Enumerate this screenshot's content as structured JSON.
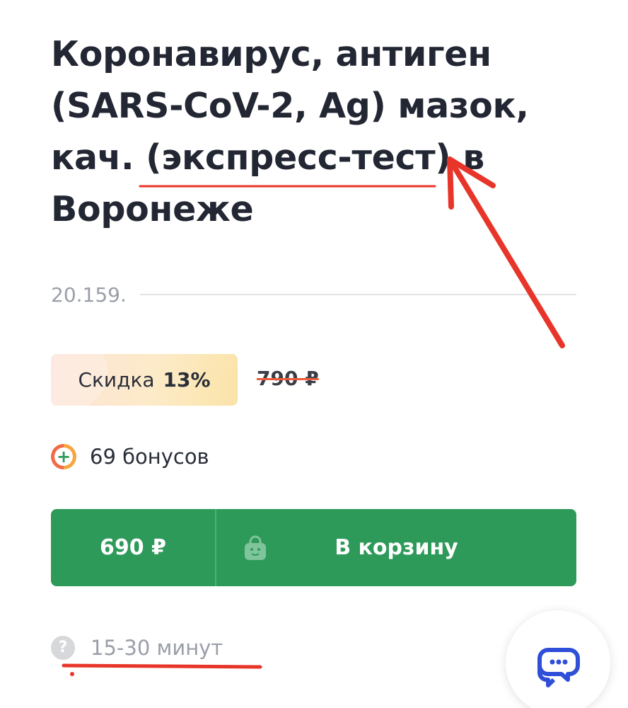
{
  "product": {
    "title": "Коронавирус, антиген (SARS-CoV-2, Ag) мазок, кач. (экспресс-тест) в Воронеже",
    "article": "20.159."
  },
  "pricing": {
    "discount_label": "Скидка",
    "discount_value": "13%",
    "old_price": "790 ₽",
    "current_price": "690 ₽",
    "bonus_text": "69 бонусов"
  },
  "actions": {
    "cart_button_label": "В корзину"
  },
  "timing": {
    "duration_text": "15-30 минут"
  },
  "icons": {
    "bonus": "plus-circle-icon",
    "cart": "shopping-bag-icon",
    "help": "question-circle-icon",
    "chat": "chat-bubbles-icon"
  },
  "colors": {
    "primary_green": "#2e9a5a",
    "title_text": "#222733",
    "muted_text": "#9a9ea8",
    "chat_icon": "#2f4fd8",
    "annotation_red": "#e8352a"
  }
}
